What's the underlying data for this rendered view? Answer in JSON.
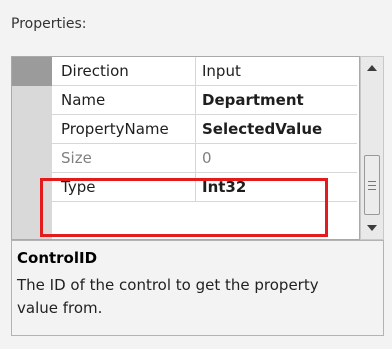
{
  "section_label": "Properties:",
  "properties": [
    {
      "name": "Direction",
      "value": "Input",
      "bold": false
    },
    {
      "name": "Name",
      "value": "Department",
      "bold": true
    },
    {
      "name": "PropertyName",
      "value": "SelectedValue",
      "bold": true
    },
    {
      "name": "Size",
      "value": "0",
      "bold": false
    },
    {
      "name": "Type",
      "value": "Int32",
      "bold": true
    }
  ],
  "highlight_color": "#e21c1c",
  "scrollbar": {
    "up_icon": "arrow-up-icon",
    "down_icon": "arrow-down-icon",
    "grip_icon": "grip-lines-icon"
  },
  "description": {
    "title": "ControlID",
    "text": "The ID of the control to get the property value from."
  }
}
